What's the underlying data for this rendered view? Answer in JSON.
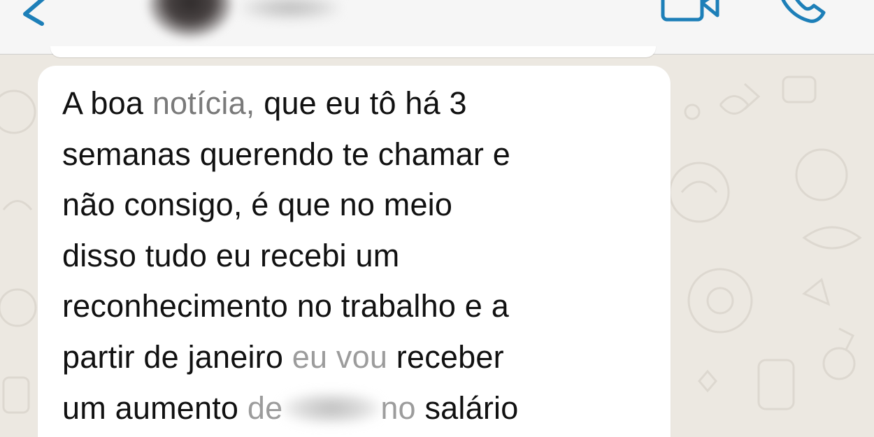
{
  "header": {
    "back_icon": "chevron-left-icon",
    "contact_name": "",
    "video_call_icon": "video-camera-icon",
    "voice_call_icon": "phone-icon",
    "accent_color": "#1d7fb8"
  },
  "message": {
    "lines": [
      [
        "A boa ",
        "notícia,",
        "  que eu tô há 3"
      ],
      [
        "semanas querendo te chamar e"
      ],
      [
        "não consigo, é que no meio"
      ],
      [
        "disso tudo eu recebi um"
      ],
      [
        "reconhecimento no trabalho e a"
      ],
      [
        "partir de janeiro ",
        "eu vou",
        " receber"
      ],
      [
        "um aumento ",
        "de",
        "no",
        " salário"
      ]
    ],
    "redacted_amount": ""
  },
  "colors": {
    "bubble": "#ffffff",
    "wallpaper": "#ece8e1",
    "header": "#f6f6f6"
  }
}
